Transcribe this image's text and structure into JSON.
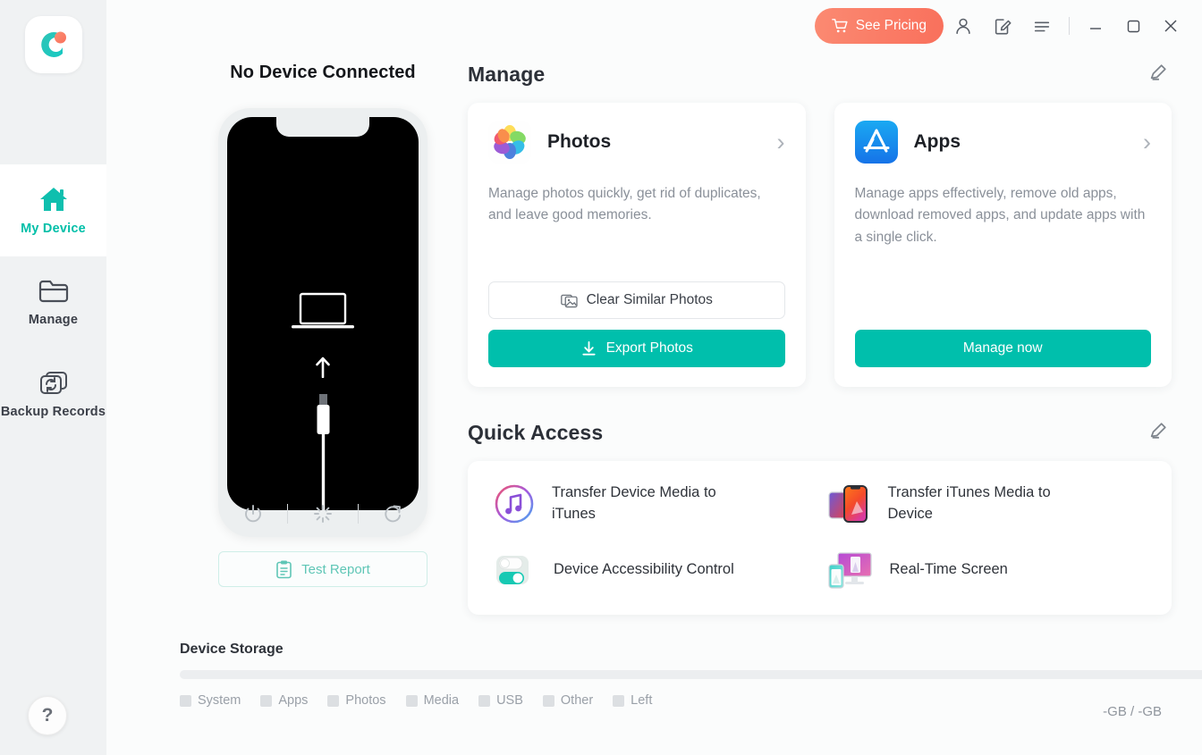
{
  "app": {
    "logo_icon": "circle-c-logo-icon"
  },
  "sidebar": {
    "items": [
      {
        "label": "My Device",
        "icon": "home-icon",
        "active": true
      },
      {
        "label": "Manage",
        "icon": "folder-icon",
        "active": false
      },
      {
        "label": "Backup Records",
        "icon": "backup-sync-icon",
        "active": false
      }
    ],
    "help_label": "?"
  },
  "titlebar": {
    "pricing_label": "See Pricing",
    "pricing_icon": "shopping-cart-icon",
    "account_icon": "user-account-icon",
    "feedback_icon": "feedback-edit-icon",
    "menu_icon": "hamburger-menu-icon",
    "minimize_icon": "minimize-icon",
    "maximize_icon": "maximize-icon",
    "close_icon": "close-icon"
  },
  "device": {
    "status_title": "No Device Connected",
    "screen_icons": [
      "laptop-icon",
      "arrow-up-icon",
      "lightning-cable-icon"
    ],
    "controls": [
      {
        "name": "power-icon"
      },
      {
        "name": "brightness-icon"
      },
      {
        "name": "refresh-icon"
      }
    ],
    "test_report_label": "Test Report",
    "test_report_icon": "clipboard-icon"
  },
  "storage": {
    "title": "Device Storage",
    "total_label": "-GB / -GB",
    "clean_icon": "broom-icon",
    "legend": [
      {
        "label": "System",
        "color": "#dcdfe2"
      },
      {
        "label": "Apps",
        "color": "#dcdfe2"
      },
      {
        "label": "Photos",
        "color": "#dcdfe2"
      },
      {
        "label": "Media",
        "color": "#dcdfe2"
      },
      {
        "label": "USB",
        "color": "#dcdfe2"
      },
      {
        "label": "Other",
        "color": "#dcdfe2"
      },
      {
        "label": "Left",
        "color": "#dcdfe2"
      }
    ]
  },
  "manage": {
    "title": "Manage",
    "edit_icon": "pencil-edit-icon",
    "cards": [
      {
        "title": "Photos",
        "icon": "apple-photos-icon",
        "chevron": "›",
        "desc": "Manage photos quickly, get rid of duplicates, and leave good memories.",
        "secondary_label": "Clear Similar Photos",
        "secondary_icon": "photo-stack-icon",
        "primary_label": "Export Photos",
        "primary_icon": "download-icon"
      },
      {
        "title": "Apps",
        "icon": "app-store-icon",
        "chevron": "›",
        "desc": "Manage apps effectively, remove old apps, download removed apps, and update apps with a single click.",
        "primary_label": "Manage now"
      }
    ]
  },
  "quick_access": {
    "title": "Quick Access",
    "edit_icon": "pencil-edit-icon",
    "items": [
      {
        "label": "Transfer Device Media to iTunes",
        "icon": "itunes-icon"
      },
      {
        "label": "Transfer iTunes Media to Device",
        "icon": "phones-transfer-icon"
      },
      {
        "label": "Device Accessibility Control",
        "icon": "toggle-switch-icon"
      },
      {
        "label": "Real-Time Screen",
        "icon": "screen-mirror-icon"
      }
    ]
  },
  "colors": {
    "accent_teal": "#00bfac",
    "accent_coral": "#f9705c",
    "sidebar_bg": "#f0f2f3",
    "text_dark": "#2c3038",
    "text_muted": "#8a9099"
  }
}
